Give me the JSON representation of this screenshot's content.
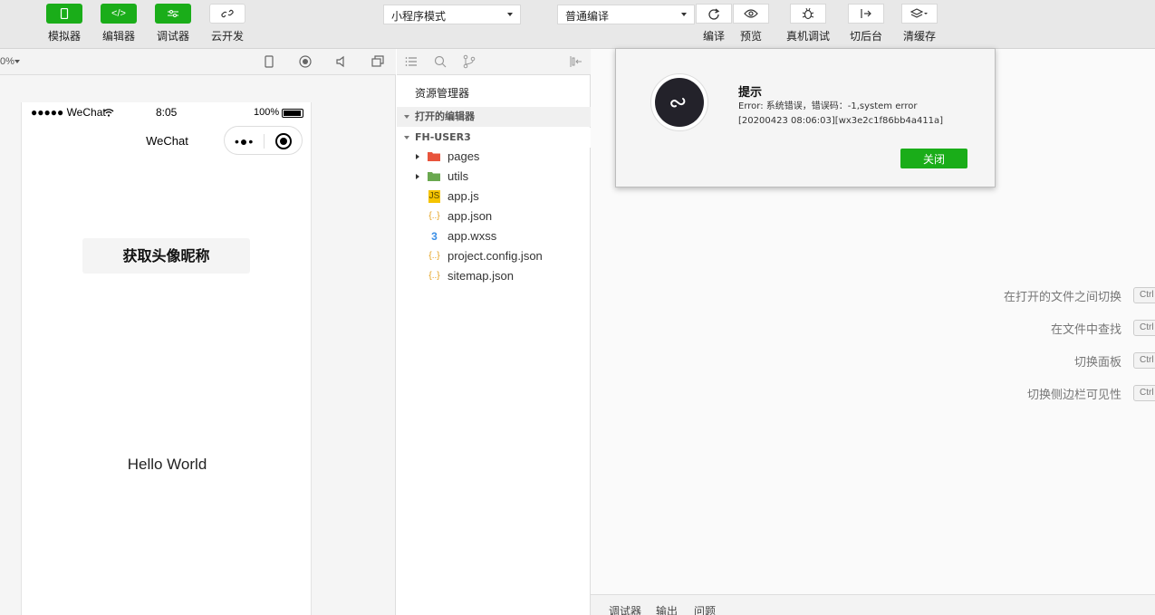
{
  "toolbar": {
    "simulator_label": "模拟器",
    "editor_label": "编辑器",
    "debugger_label": "调试器",
    "cloud_label": "云开发",
    "mode_select": "小程序模式",
    "compile_select": "普通编译",
    "compile_label": "编译",
    "preview_label": "预览",
    "real_debug_label": "真机调试",
    "backstage_label": "切后台",
    "clear_cache_label": "清缓存"
  },
  "simulator": {
    "zoom": "0%",
    "status_signal": "●●●●● WeChat",
    "status_time": "8:05",
    "status_battery": "100%",
    "nav_title": "WeChat",
    "capsule_dots": "•●•",
    "avatar_button": "获取头像昵称",
    "hello_text": "Hello World"
  },
  "explorer": {
    "title": "资源管理器",
    "open_editors": "打开的编辑器",
    "project": "FH-USER3",
    "files": [
      {
        "name": "pages",
        "type": "folder"
      },
      {
        "name": "utils",
        "type": "folder"
      },
      {
        "name": "app.js",
        "type": "js"
      },
      {
        "name": "app.json",
        "type": "json"
      },
      {
        "name": "app.wxss",
        "type": "wxss"
      },
      {
        "name": "project.config.json",
        "type": "json"
      },
      {
        "name": "sitemap.json",
        "type": "json"
      }
    ]
  },
  "editor": {
    "shortcuts": [
      {
        "label": "在打开的文件之间切换",
        "key": "Ctrl"
      },
      {
        "label": "在文件中查找",
        "key": "Ctrl"
      },
      {
        "label": "切换面板",
        "key": "Ctrl"
      },
      {
        "label": "切换侧边栏可见性",
        "key": "Ctrl"
      }
    ],
    "bottom_tabs": [
      "调试器",
      "输出",
      "问题"
    ]
  },
  "dialog": {
    "title": "提示",
    "line1": "Error: 系统错误，错误码：-1,system error",
    "line2": "[20200423 08:06:03][wx3e2c1f86bb4a411a]",
    "close_label": "关闭"
  },
  "colors": {
    "accent": "#1aad19",
    "toolbar_bg": "#e8e8e8",
    "logo_bg": "#23222a"
  }
}
